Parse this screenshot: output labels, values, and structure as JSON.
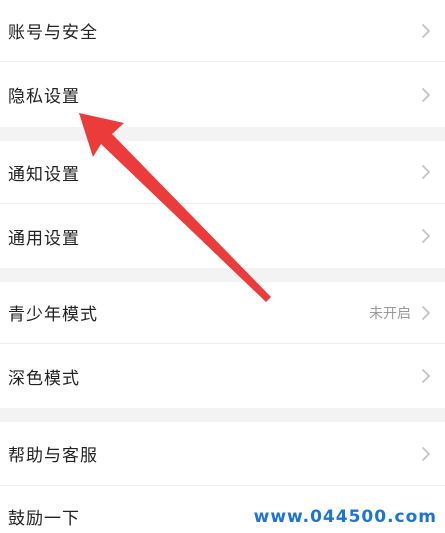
{
  "settings": {
    "account_security": "账号与安全",
    "privacy_settings": "隐私设置",
    "notification_settings": "通知设置",
    "general_settings": "通用设置",
    "teen_mode": "青少年模式",
    "teen_mode_status": "未开启",
    "dark_mode": "深色模式",
    "help_support": "帮助与客服",
    "encourage": "鼓励一下"
  },
  "watermark": "www.044500.com",
  "colors": {
    "annotation_arrow": "#ec3b3b",
    "watermark": "#1e73d8",
    "gap_background": "#f3f3f3"
  }
}
